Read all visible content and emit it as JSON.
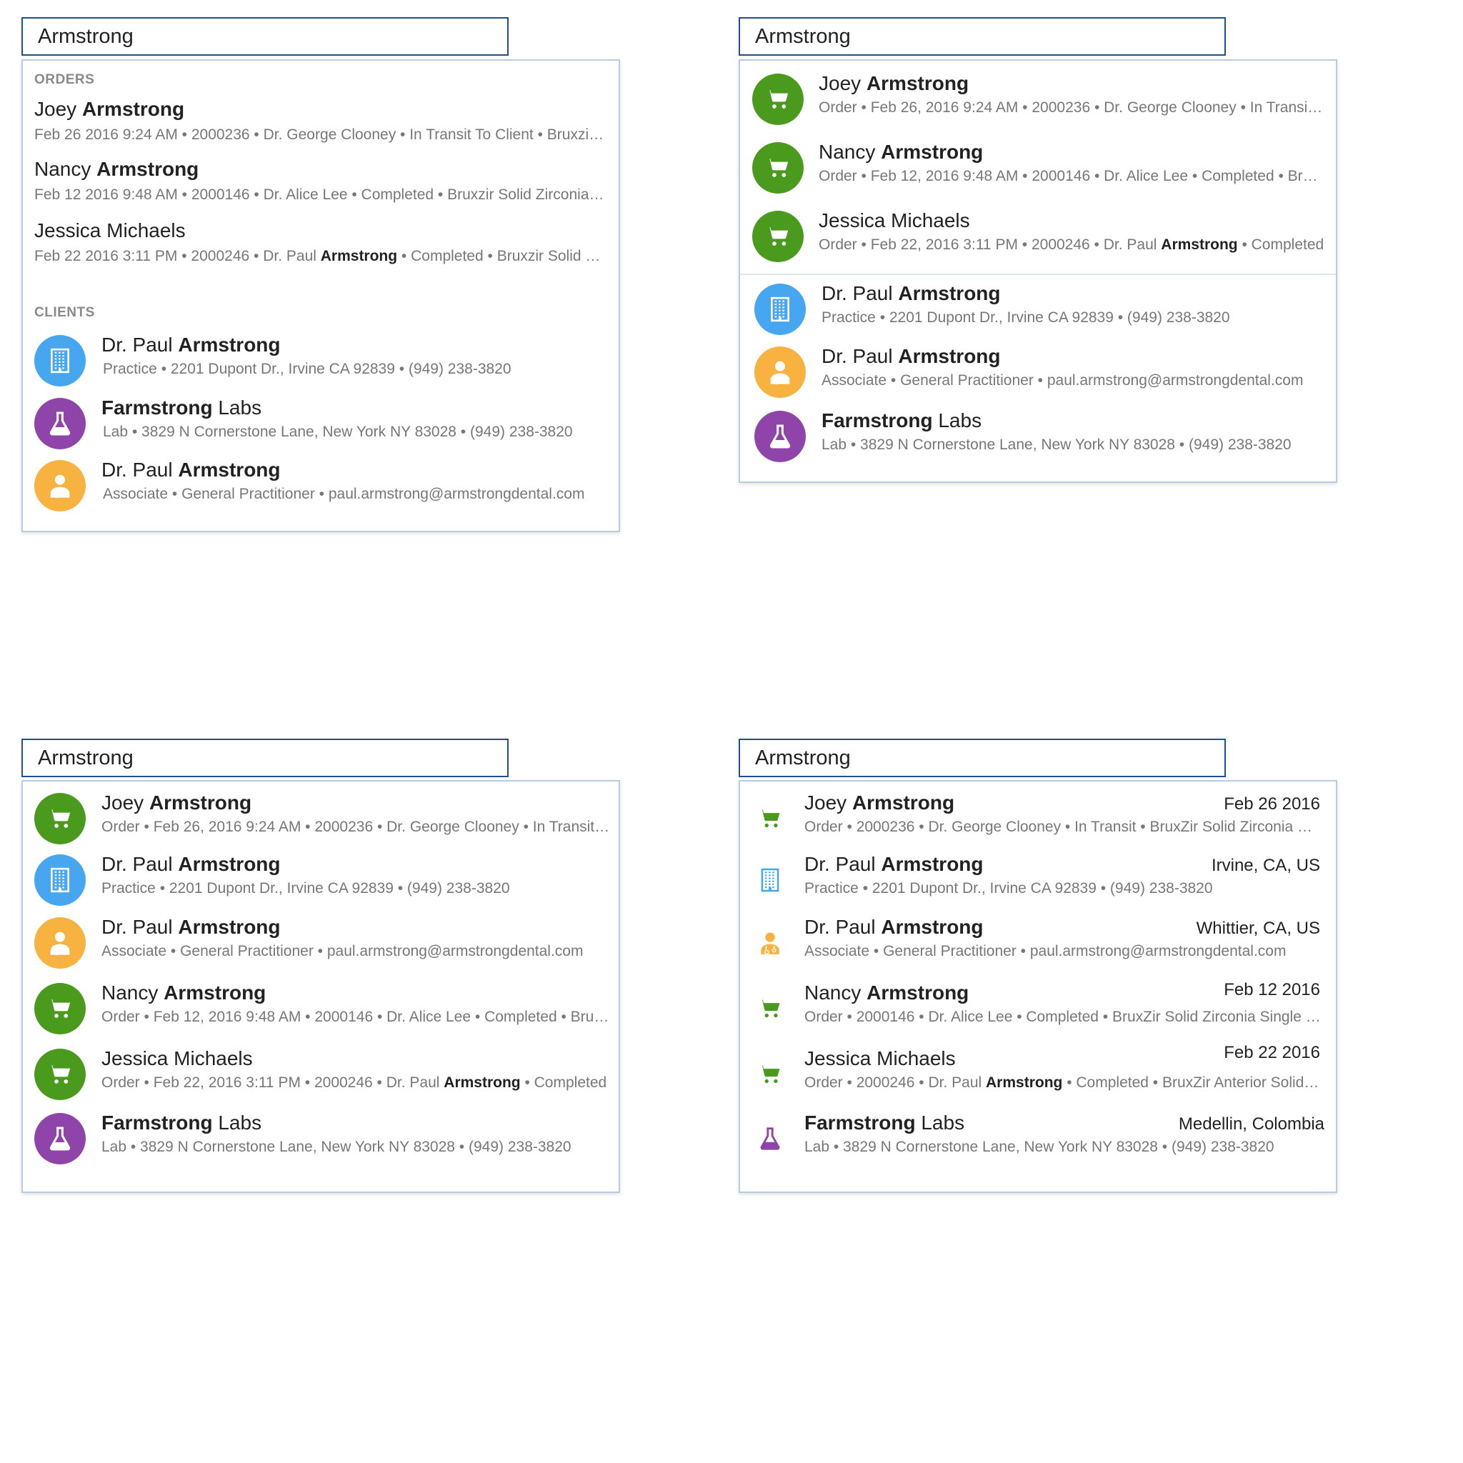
{
  "query": "Armstrong",
  "colors": {
    "order": "#4a9a1e",
    "practice": "#46a6f0",
    "associate": "#f8b23f",
    "lab": "#8e44a8",
    "search_border": "#1f4f8f"
  },
  "panel_a": {
    "orders_label": "ORDERS",
    "clients_label": "CLIENTS",
    "orders": [
      {
        "first": "Joey",
        "last": "Armstrong",
        "sub": "Feb 26 2016 9:24 AM • 2000236 • Dr. George Clooney • In Transit To Client • Bruxzir Solid Zirconia"
      },
      {
        "first": "Nancy",
        "last": "Armstrong",
        "sub": "Feb 12 2016 9:48 AM • 2000146 • Dr. Alice Lee • Completed • Bruxzir Solid Zirconia Single Crown"
      },
      {
        "name": "Jessica Michaels",
        "sub_pre": "Feb 22 2016 3:11 PM • 2000246 • Dr. Paul ",
        "sub_bold": "Armstrong",
        "sub_post": " • Completed • Bruxzir Solid Zirconia"
      }
    ],
    "clients": [
      {
        "icon": "building-icon",
        "first": "Dr. Paul",
        "last": "Armstrong",
        "sub": "Practice • 2201 Dupont Dr., Irvine CA 92839 • (949) 238-3820"
      },
      {
        "icon": "flask-icon",
        "first": "Farmstrong",
        "last": "Labs",
        "sub": "Lab • 3829 N Cornerstone Lane, New York NY 83028 • (949) 238-3820"
      },
      {
        "icon": "doctor-icon",
        "first": "Dr. Paul",
        "last": "Armstrong",
        "sub": "Associate • General Practitioner • paul.armstrong@armstrongdental.com"
      }
    ]
  },
  "panel_b": {
    "orders": [
      {
        "first": "Joey",
        "last": "Armstrong",
        "sub": "Order • Feb 26, 2016 9:24 AM • 2000236 • Dr. George Clooney • In Transit To Client"
      },
      {
        "first": "Nancy",
        "last": "Armstrong",
        "sub": "Order • Feb 12, 2016 9:48 AM • 2000146 • Dr. Alice Lee • Completed • Bruxzir"
      },
      {
        "name": "Jessica Michaels",
        "sub_pre": "Order • Feb 22, 2016 3:11 PM • 2000246 • Dr. Paul ",
        "sub_bold": "Armstrong",
        "sub_post": " • Completed"
      }
    ],
    "clients": [
      {
        "icon": "building-icon",
        "first": "Dr. Paul",
        "last": "Armstrong",
        "sub": "Practice • 2201 Dupont Dr., Irvine CA 92839 • (949) 238-3820"
      },
      {
        "icon": "doctor-icon",
        "first": "Dr. Paul",
        "last": "Armstrong",
        "sub": "Associate • General Practitioner • paul.armstrong@armstrongdental.com"
      },
      {
        "icon": "flask-icon",
        "first": "Farmstrong",
        "last": "Labs",
        "sub": "Lab • 3829 N Cornerstone Lane, New York NY 83028 • (949) 238-3820"
      }
    ]
  },
  "panel_c": {
    "items": [
      {
        "icon": "cart-icon",
        "first": "Joey",
        "last": "Armstrong",
        "sub": "Order • Feb 26, 2016 9:24 AM • 2000236 • Dr. George Clooney • In Transit To Client"
      },
      {
        "icon": "building-icon",
        "first": "Dr. Paul",
        "last": "Armstrong",
        "sub": "Practice • 2201 Dupont Dr., Irvine CA 92839 • (949) 238-3820"
      },
      {
        "icon": "doctor-icon",
        "first": "Dr. Paul",
        "last": "Armstrong",
        "sub": "Associate • General Practitioner • paul.armstrong@armstrongdental.com"
      },
      {
        "icon": "cart-icon",
        "first": "Nancy",
        "last": "Armstrong",
        "sub": "Order • Feb 12, 2016 9:48 AM • 2000146 • Dr. Alice Lee • Completed • Bruxzir"
      },
      {
        "icon": "cart-icon",
        "name": "Jessica Michaels",
        "sub_pre": "Order • Feb 22, 2016 3:11 PM • 2000246 • Dr. Paul ",
        "sub_bold": "Armstrong",
        "sub_post": " • Completed"
      },
      {
        "icon": "flask-icon",
        "first": "Farmstrong",
        "last": "Labs",
        "sub": "Lab • 3829 N Cornerstone Lane, New York NY 83028 • (949) 238-3820"
      }
    ]
  },
  "panel_d": {
    "items": [
      {
        "icon": "cart-icon",
        "first": "Joey",
        "last": "Armstrong",
        "right": "Feb 26 2016",
        "sub": "Order • 2000236 • Dr. George Clooney • In Transit • BruxZir Solid Zirconia Crown"
      },
      {
        "icon": "building-icon",
        "first": "Dr. Paul",
        "last": "Armstrong",
        "right": "Irvine, CA, US",
        "sub": "Practice • 2201 Dupont Dr., Irvine CA 92839 • (949) 238-3820"
      },
      {
        "icon": "doctor-icon",
        "first": "Dr. Paul",
        "last": "Armstrong",
        "right": "Whittier, CA, US",
        "sub": "Associate • General Practitioner • paul.armstrong@armstrongdental.com"
      },
      {
        "icon": "cart-icon",
        "first": "Nancy",
        "last": "Armstrong",
        "right": "Feb 12 2016",
        "sub": "Order • 2000146 • Dr. Alice Lee • Completed • BruxZir Solid Zirconia Single Crown"
      },
      {
        "icon": "cart-icon",
        "name": "Jessica Michaels",
        "right": "Feb 22 2016",
        "sub_pre": "Order • 2000246 • Dr. Paul ",
        "sub_bold": "Armstrong",
        "sub_post": " • Completed • BruxZir Anterior Solid Zirconia"
      },
      {
        "icon": "flask-icon",
        "first": "Farmstrong",
        "last": "Labs",
        "right": "Medellin, Colombia",
        "sub": "Lab • 3829 N Cornerstone Lane, New York NY 83028 • (949) 238-3820"
      }
    ]
  }
}
